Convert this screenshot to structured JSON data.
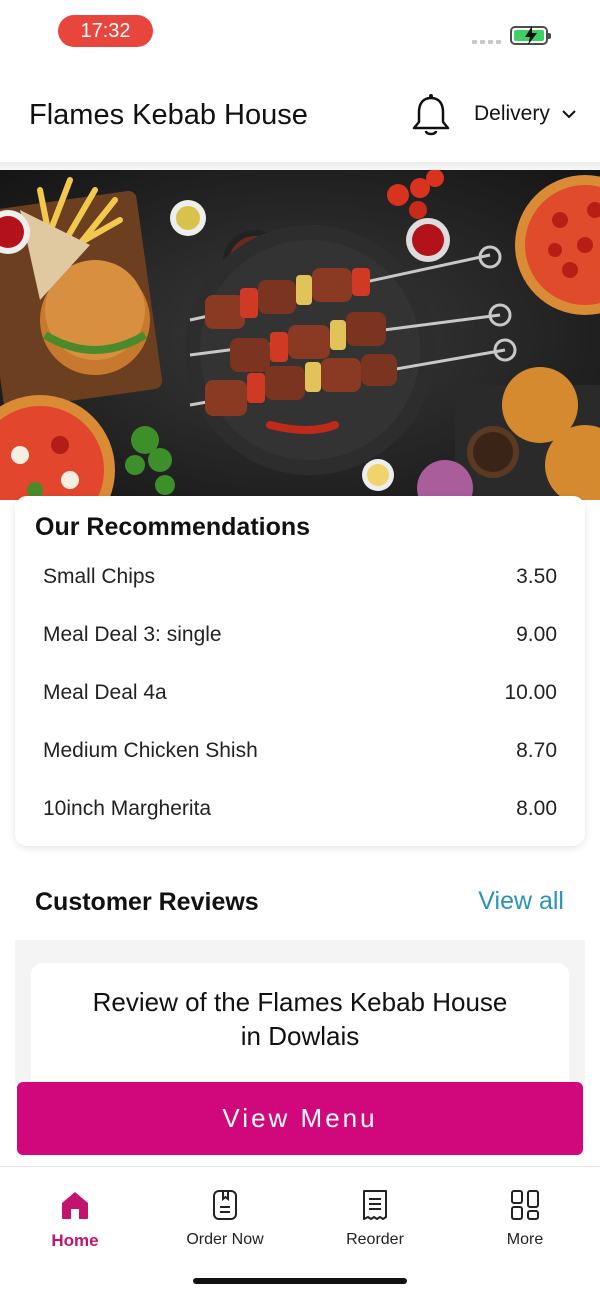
{
  "status_bar": {
    "time": "17:32",
    "battery_color": "#3ed063",
    "time_pill_color": "#e8453c"
  },
  "header": {
    "title": "Flames Kebab House",
    "mode_selector": "Delivery",
    "icon_bell": "bell-icon",
    "icon_chevron": "chevron-down-icon"
  },
  "hero": {
    "description_icon": "food-banner-image"
  },
  "recommendations": {
    "title": "Our Recommendations",
    "items": [
      {
        "name": "Small Chips",
        "price": "3.50"
      },
      {
        "name": "Meal Deal 3: single",
        "price": "9.00"
      },
      {
        "name": "Meal Deal 4a",
        "price": "10.00"
      },
      {
        "name": "Medium Chicken Shish",
        "price": "8.70"
      },
      {
        "name": "10inch Margherita",
        "price": "8.00"
      }
    ]
  },
  "reviews": {
    "title": "Customer Reviews",
    "view_all": "View all",
    "review_line1": "Review of the Flames Kebab House",
    "review_line2": "in Dowlais"
  },
  "cta": {
    "label": "View Menu",
    "color": "#d1077c"
  },
  "tabbar": {
    "active_color": "#c4126f",
    "tabs": [
      {
        "label": "Home",
        "icon": "home-icon"
      },
      {
        "label": "Order Now",
        "icon": "order-icon"
      },
      {
        "label": "Reorder",
        "icon": "receipt-icon"
      },
      {
        "label": "More",
        "icon": "grid-icon"
      }
    ]
  }
}
